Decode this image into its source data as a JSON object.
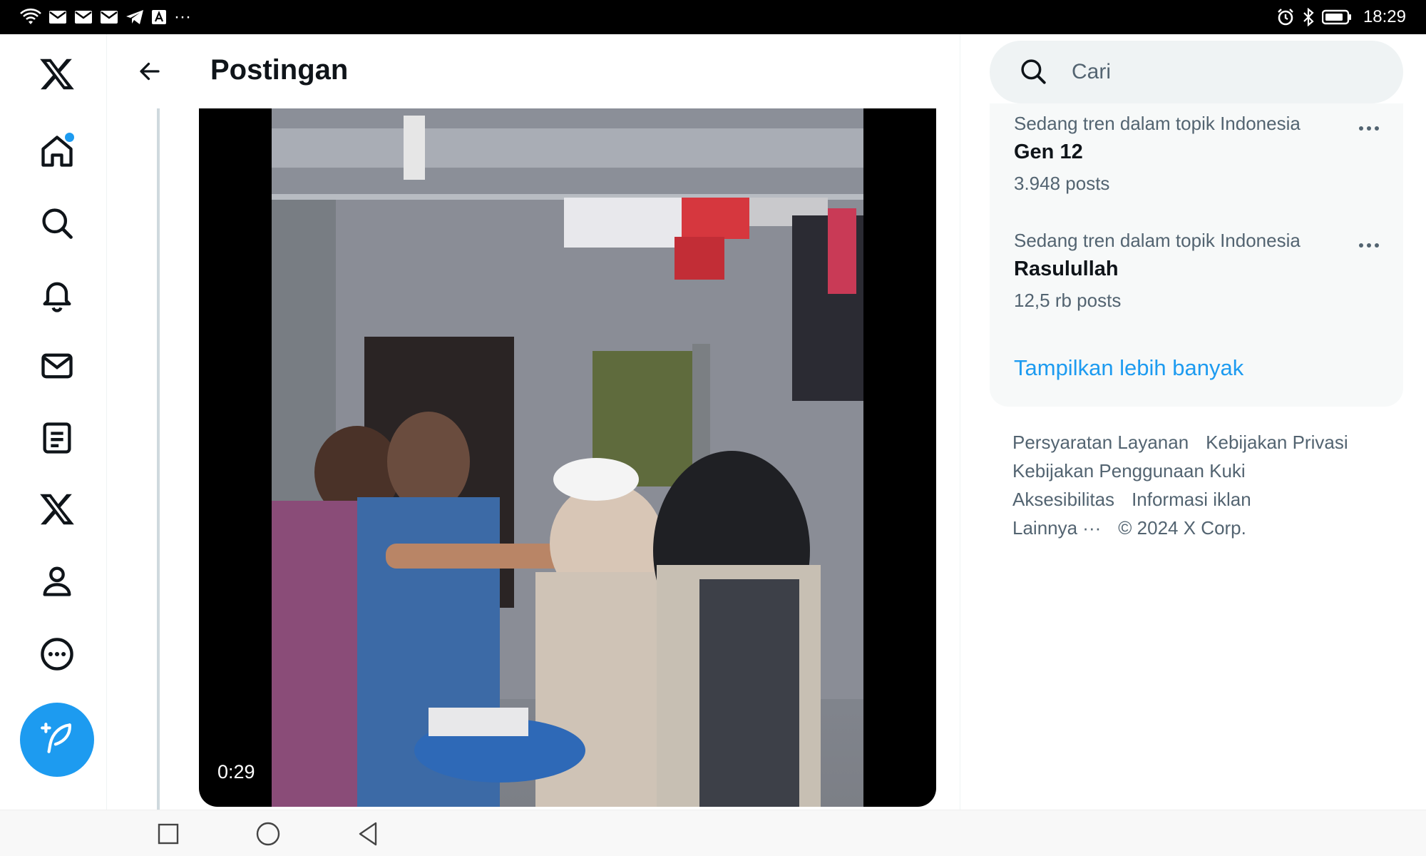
{
  "status_bar": {
    "time": "18:29",
    "left_icons": [
      "wifi-icon",
      "gmail-icon",
      "gmail-icon",
      "gmail-icon",
      "telegram-icon",
      "app-a-icon",
      "more-dots-icon"
    ],
    "right_icons": [
      "alarm-icon",
      "bluetooth-icon",
      "battery-icon"
    ],
    "overflow": "···"
  },
  "nav": {
    "items": [
      "x-logo-icon",
      "home-icon",
      "explore-icon",
      "notifications-icon",
      "messages-icon",
      "lists-icon",
      "premium-x-icon",
      "profile-icon",
      "more-icon"
    ],
    "compose_icon": "compose-post-icon"
  },
  "header": {
    "title": "Postingan"
  },
  "video": {
    "duration": "0:29"
  },
  "search": {
    "placeholder": "Cari"
  },
  "trends": [
    {
      "category": "Sedang tren dalam topik Indonesia",
      "name": "Gen 12",
      "count": "3.948 posts"
    },
    {
      "category": "Sedang tren dalam topik Indonesia",
      "name": "Rasulullah",
      "count": "12,5 rb posts"
    }
  ],
  "show_more": "Tampilkan lebih banyak",
  "footer": {
    "terms": "Persyaratan Layanan",
    "privacy": "Kebijakan Privasi",
    "cookies": "Kebijakan Penggunaan Kuki",
    "accessibility": "Aksesibilitas",
    "ads_info": "Informasi iklan",
    "more": "Lainnya ···",
    "copyright": "© 2024 X Corp."
  },
  "colors": {
    "accent": "#1d9bf0",
    "text_primary": "#0f1419",
    "text_secondary": "#536471"
  }
}
